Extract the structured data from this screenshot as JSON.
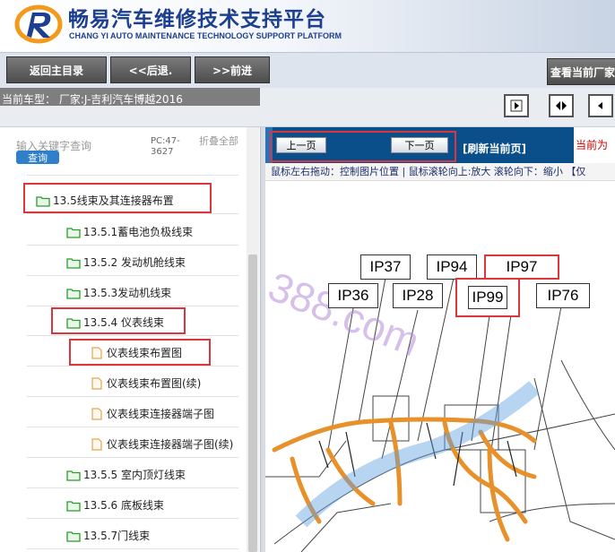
{
  "header": {
    "title": "畅易汽车维修技术支持平台",
    "subtitle": "CHANG YI AUTO MAINTENANCE TECHNOLOGY SUPPORT PLATFORM"
  },
  "toolbar": {
    "home": "返回主目录",
    "back": "<<后退.",
    "forward": ">>前进",
    "view_current": "查看当前厂家"
  },
  "info": {
    "car_model": "当前车型：  厂家:J-吉利汽车博越2016"
  },
  "search": {
    "label": "输入关键字查询",
    "button": "查询",
    "pc": "PC:47-3627",
    "fold_all": "折叠全部"
  },
  "tree": [
    {
      "label": "13.5线束及其连接器布置",
      "type": "folder"
    },
    {
      "label": "13.5.1蓄电池负极线束",
      "type": "folder"
    },
    {
      "label": "13.5.2 发动机舱线束",
      "type": "folder"
    },
    {
      "label": "13.5.3发动机线束",
      "type": "folder"
    },
    {
      "label": "13.5.4 仪表线束",
      "type": "folder"
    },
    {
      "label": "仪表线束布置图",
      "type": "page"
    },
    {
      "label": "仪表线束布置图(续)",
      "type": "page"
    },
    {
      "label": "仪表线束连接器端子图",
      "type": "page"
    },
    {
      "label": "仪表线束连接器端子图(续)",
      "type": "page"
    },
    {
      "label": "13.5.5 室内顶灯线束",
      "type": "folder"
    },
    {
      "label": "13.5.6 底板线束",
      "type": "folder"
    },
    {
      "label": "13.5.7门线束",
      "type": "folder"
    }
  ],
  "pager": {
    "prev": "上一页",
    "next": "下一页",
    "refresh": "[刷新当前页]",
    "current_page": "当前为"
  },
  "hint": "鼠标左右拖动：控制图片位置 | 鼠标滚轮向上:放大  滚轮向下：缩小 【仅",
  "diagram": {
    "connectors": [
      "IP37",
      "IP94",
      "IP97",
      "IP36",
      "IP28",
      "IP99",
      "IP76"
    ],
    "watermark": "388.com",
    "colors": {
      "harness": "#e8912a",
      "line": "#444444",
      "highlight": "#d9363e"
    }
  }
}
